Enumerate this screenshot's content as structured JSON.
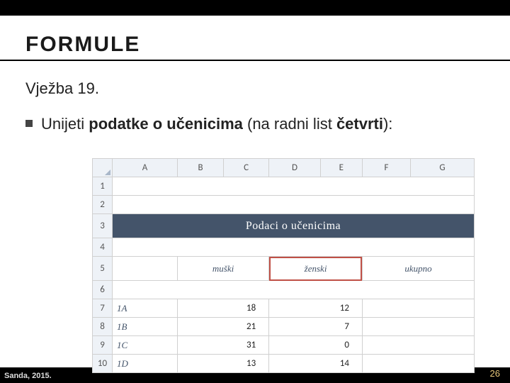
{
  "title": "FORMULE",
  "subtitle": "Vježba 19.",
  "bullet": {
    "pre": "Unijeti ",
    "bold1": "podatke o učenicima",
    "mid": " (na radni list ",
    "bold2": "četvrti",
    "post": "):"
  },
  "sheet": {
    "cols": [
      "A",
      "B",
      "C",
      "D",
      "E",
      "F",
      "G"
    ],
    "mergedTitle": "Podaci o učenicima",
    "headers": {
      "muski": "muški",
      "zenski": "ženski",
      "ukupno": "ukupno"
    },
    "rows": [
      {
        "n": "7",
        "cls": "1A",
        "m": "18",
        "z": "12"
      },
      {
        "n": "8",
        "cls": "1B",
        "m": "21",
        "z": "7"
      },
      {
        "n": "9",
        "cls": "1C",
        "m": "31",
        "z": "0"
      },
      {
        "n": "10",
        "cls": "1D",
        "m": "13",
        "z": "14"
      }
    ],
    "rownums": [
      "1",
      "2",
      "3",
      "4",
      "5",
      "6"
    ]
  },
  "footer": {
    "left": "Sanda, 2015.",
    "right": "26"
  }
}
